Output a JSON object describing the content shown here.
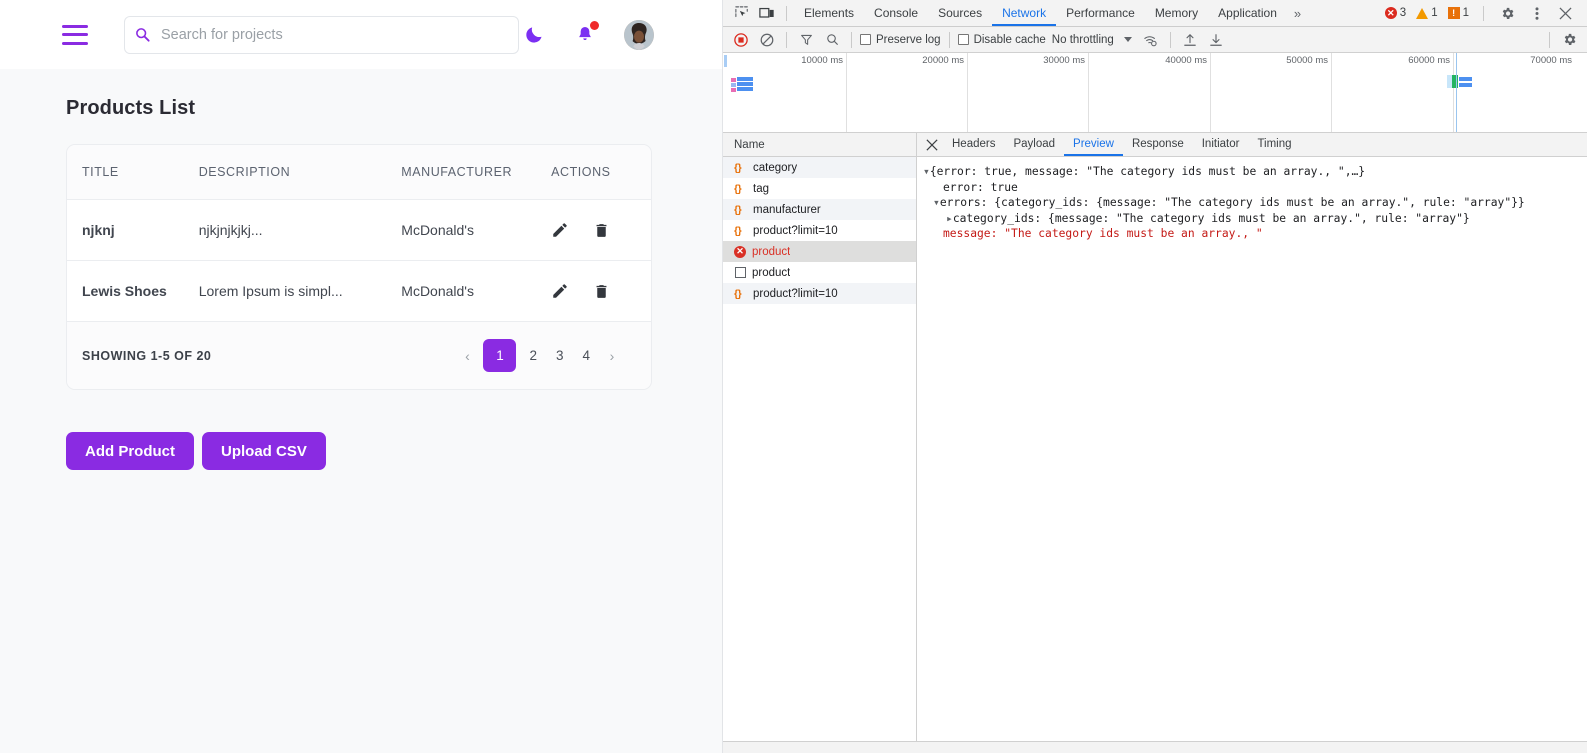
{
  "app": {
    "header": {
      "menu_icon": "hamburger-icon",
      "search": {
        "placeholder": "Search for projects",
        "value": "",
        "icon": "search-icon"
      },
      "theme_toggle_icon": "moon-icon",
      "notifications_icon": "bell-icon",
      "avatar_icon": "user-avatar"
    },
    "page_title": "Products List",
    "table": {
      "columns": [
        "TITLE",
        "DESCRIPTION",
        "MANUFACTURER",
        "ACTIONS"
      ],
      "rows": [
        {
          "title": "njknj",
          "description": "njkjnjkjkj...",
          "manufacturer": "McDonald's"
        },
        {
          "title": "Lewis Shoes",
          "description": "Lorem Ipsum is simpl...",
          "manufacturer": "McDonald's"
        }
      ],
      "row_actions": {
        "edit_icon": "pencil-icon",
        "delete_icon": "trash-icon"
      }
    },
    "pagination": {
      "showing": "SHOWING 1-5 OF 20",
      "prev": "‹",
      "next": "›",
      "pages": [
        "1",
        "2",
        "3",
        "4"
      ],
      "active_page": "1"
    },
    "buttons": {
      "add_product": "Add Product",
      "upload_csv": "Upload CSV"
    },
    "accent_color": "#8a2be2"
  },
  "devtools": {
    "tabs": [
      {
        "label": "Elements",
        "active": false
      },
      {
        "label": "Console",
        "active": false
      },
      {
        "label": "Sources",
        "active": false
      },
      {
        "label": "Network",
        "active": true
      },
      {
        "label": "Performance",
        "active": false
      },
      {
        "label": "Memory",
        "active": false
      },
      {
        "label": "Application",
        "active": false
      }
    ],
    "more_tabs": "»",
    "status": {
      "errors": "3",
      "warnings": "1",
      "infos": "1"
    },
    "settings_icon": "gear-icon",
    "kebab_icon": "more-vertical-icon",
    "close_icon": "close-icon",
    "inspect_icon": "inspect-element-icon",
    "device_icon": "device-toolbar-icon",
    "toolbar": {
      "record_icon": "record-stop-icon",
      "clear_icon": "clear-icon",
      "filter_icon": "filter-icon",
      "search_icon": "search-icon",
      "preserve_log": "Preserve log",
      "disable_cache": "Disable cache",
      "throttling": "No throttling",
      "throttle_settings_icon": "network-conditions-icon",
      "import_icon": "import-har-icon",
      "export_icon": "export-har-icon",
      "panel_settings_icon": "gear-icon"
    },
    "overview": {
      "ticks": [
        "10000 ms",
        "20000 ms",
        "30000 ms",
        "40000 ms",
        "50000 ms",
        "60000 ms",
        "70000 ms"
      ]
    },
    "request_list": {
      "header": "Name",
      "rows": [
        {
          "name": "category",
          "type": "json",
          "selected": false
        },
        {
          "name": "tag",
          "type": "json",
          "selected": false
        },
        {
          "name": "manufacturer",
          "type": "json",
          "selected": false
        },
        {
          "name": "product?limit=10",
          "type": "json",
          "selected": false
        },
        {
          "name": "product",
          "type": "error",
          "selected": true
        },
        {
          "name": "product",
          "type": "doc",
          "selected": false
        },
        {
          "name": "product?limit=10",
          "type": "json",
          "selected": false
        }
      ]
    },
    "detail": {
      "tabs": [
        {
          "label": "Headers",
          "active": false
        },
        {
          "label": "Payload",
          "active": false
        },
        {
          "label": "Preview",
          "active": true
        },
        {
          "label": "Response",
          "active": false
        },
        {
          "label": "Initiator",
          "active": false
        },
        {
          "label": "Timing",
          "active": false
        }
      ],
      "preview_lines": [
        "{error: true, message: \"The category ids must be an array., \",…}",
        "error: true",
        "errors: {category_ids: {message: \"The category ids must be an array.\", rule: \"array\"}}",
        "category_ids: {message: \"The category ids must be an array.\", rule: \"array\"}",
        "message: \"The category ids must be an array., \""
      ]
    }
  }
}
